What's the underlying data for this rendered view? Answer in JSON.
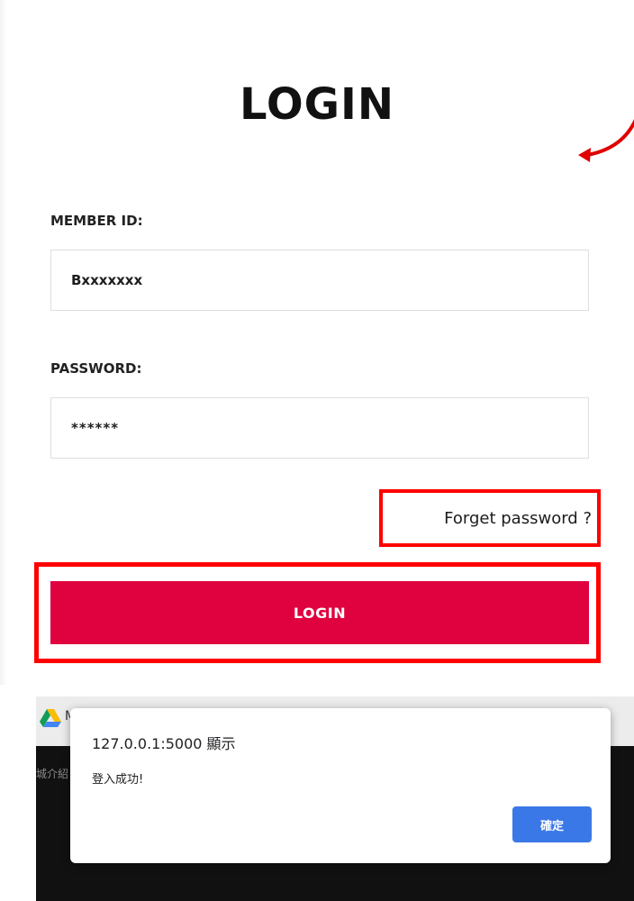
{
  "header": {
    "title": "LOGIN"
  },
  "form": {
    "member_id": {
      "label": "MEMBER ID:",
      "value": "Bxxxxxxx"
    },
    "password": {
      "label": "PASSWORD:",
      "value": "******"
    },
    "forget_link": "Forget password ?",
    "submit_label": "LOGIN"
  },
  "browser": {
    "tab_initial": "M",
    "tab_icon": "google-drive-icon",
    "side_text": "城介紹",
    "background_color": "#111111"
  },
  "alert": {
    "title": "127.0.0.1:5000 顯示",
    "message": "登入成功!",
    "ok_label": "確定"
  },
  "colors": {
    "accent": "#e0013f",
    "highlight": "#ff0000",
    "dialog_button": "#3b78e7"
  }
}
